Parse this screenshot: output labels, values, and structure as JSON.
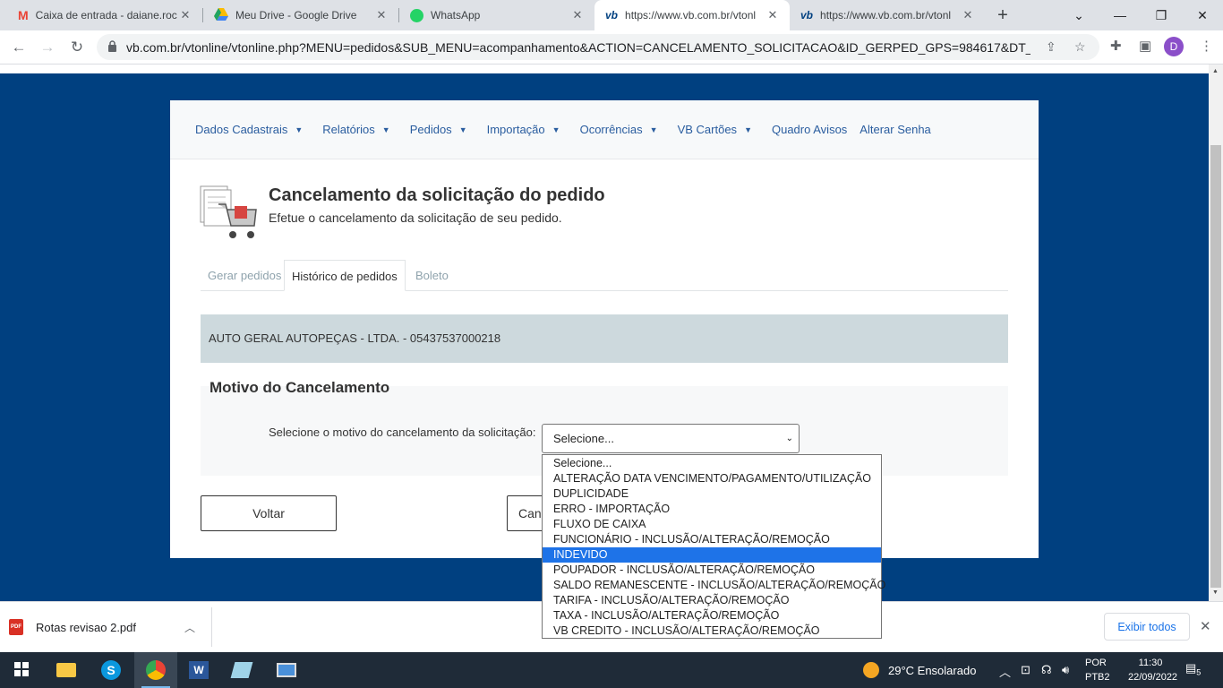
{
  "browser": {
    "tabs": [
      {
        "title": "Caixa de entrada - daiane.roc",
        "icon": "gmail-icon"
      },
      {
        "title": "Meu Drive - Google Drive",
        "icon": "google-drive-icon"
      },
      {
        "title": "WhatsApp",
        "icon": "whatsapp-icon"
      },
      {
        "title": "https://www.vb.com.br/vtonl",
        "icon": "vb-icon",
        "active": true
      },
      {
        "title": "https://www.vb.com.br/vtonl",
        "icon": "vb-icon"
      }
    ],
    "url": "vb.com.br/vtonline/vtonline.php?MENU=pedidos&SUB_MENU=acompanhamento&ACTION=CANCELAMENTO_SOLICITACAO&ID_GERPED_GPS=984617&DT_SOLI...",
    "profile_initial": "D"
  },
  "menu": [
    {
      "label": "Dados Cadastrais",
      "has_dropdown": true
    },
    {
      "label": "Relatórios",
      "has_dropdown": true
    },
    {
      "label": "Pedidos",
      "has_dropdown": true
    },
    {
      "label": "Importação",
      "has_dropdown": true
    },
    {
      "label": "Ocorrências",
      "has_dropdown": true
    },
    {
      "label": "VB Cartões",
      "has_dropdown": true
    },
    {
      "label": "Quadro Avisos",
      "has_dropdown": false
    },
    {
      "label": "Alterar Senha",
      "has_dropdown": false
    }
  ],
  "header": {
    "title": "Cancelamento da solicitação do pedido",
    "subtitle": "Efetue o cancelamento da solicitação de seu pedido."
  },
  "page_tabs": [
    {
      "label": "Gerar pedidos",
      "active": false
    },
    {
      "label": "Histórico de pedidos",
      "active": true
    },
    {
      "label": "Boleto",
      "active": false
    }
  ],
  "company": "AUTO GERAL AUTOPEÇAS - LTDA. - 05437537000218",
  "motivo": {
    "title": "Motivo do Cancelamento",
    "label": "Selecione o motivo do cancelamento da solicitação:",
    "selected": "Selecione...",
    "options": [
      "Selecione...",
      "ALTERAÇÃO DATA VENCIMENTO/PAGAMENTO/UTILIZAÇÃO",
      "DUPLICIDADE",
      "ERRO - IMPORTAÇÃO",
      "FLUXO DE CAIXA",
      "FUNCIONÁRIO - INCLUSÃO/ALTERAÇÃO/REMOÇÃO",
      "INDEVIDO",
      "POUPADOR - INCLUSÃO/ALTERAÇÃO/REMOÇÃO",
      "SALDO REMANESCENTE - INCLUSÃO/ALTERAÇÃO/REMOÇÃO",
      "TARIFA - INCLUSÃO/ALTERAÇÃO/REMOÇÃO",
      "TAXA - INCLUSÃO/ALTERAÇÃO/REMOÇÃO",
      "VB CREDITO - INCLUSÃO/ALTERAÇÃO/REMOÇÃO"
    ],
    "highlighted_index": 6
  },
  "buttons": {
    "back": "Voltar",
    "cancel_partial": "Can"
  },
  "downloads": {
    "file": "Rotas revisao 2.pdf",
    "show_all": "Exibir todos"
  },
  "taskbar": {
    "weather": "29°C  Ensolarado",
    "lang_line1": "POR",
    "lang_line2": "PTB2",
    "time": "11:30",
    "date": "22/09/2022",
    "notifications": "5"
  },
  "colors": {
    "page_background": "#004080",
    "menu_link": "#2a5d9f",
    "selected_option": "#1e73e8"
  }
}
